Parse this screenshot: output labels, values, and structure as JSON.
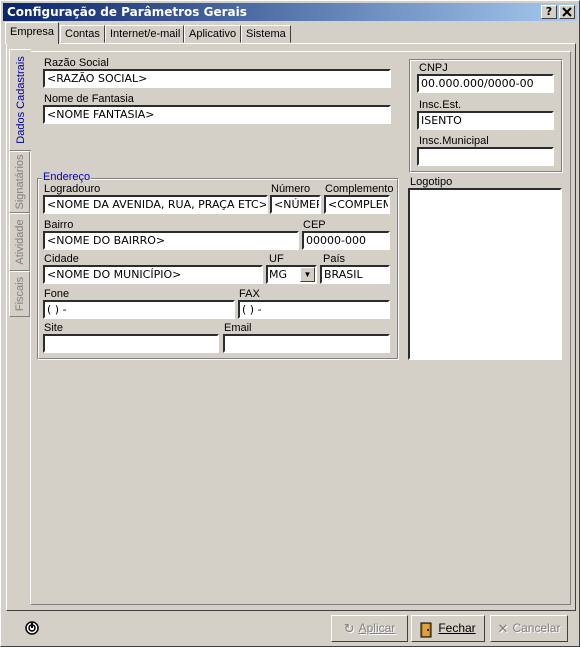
{
  "window": {
    "title": "Configuração de Parâmetros Gerais",
    "help_label": "?",
    "close_label": "X"
  },
  "tabs": [
    "Empresa",
    "Contas",
    "Internet/e-mail",
    "Aplicativo",
    "Sistema"
  ],
  "side_tabs": [
    "Dados Cadastrais",
    "Signatários",
    "Atividade",
    "Fiscais"
  ],
  "fields": {
    "razao_social": {
      "label": "Razão Social",
      "value": "<RAZÃO SOCIAL>"
    },
    "nome_fantasia": {
      "label": "Nome de Fantasia",
      "value": "<NOME FANTASIA>"
    },
    "cnpj": {
      "label": "CNPJ",
      "value": "00.000.000/0000-00"
    },
    "insc_est": {
      "label": "Insc.Est.",
      "value": "ISENTO"
    },
    "insc_municipal": {
      "label": "Insc.Municipal",
      "value": ""
    }
  },
  "endereco": {
    "legend": "Endereço",
    "logradouro": {
      "label": "Logradouro",
      "value": "<NOME DA AVENIDA, RUA, PRAÇA ETC>"
    },
    "numero": {
      "label": "Número",
      "value": "<NÚMERO>"
    },
    "complemento": {
      "label": "Complemento",
      "value": "<COMPLEMENTO>"
    },
    "bairro": {
      "label": "Bairro",
      "value": "<NOME DO BAIRRO>"
    },
    "cep": {
      "label": "CEP",
      "value": "00000-000"
    },
    "cidade": {
      "label": "Cidade",
      "value": "<NOME DO MUNICÍPIO>"
    },
    "uf": {
      "label": "UF",
      "value": "MG"
    },
    "pais": {
      "label": "País",
      "value": "BRASIL"
    },
    "fone": {
      "label": "Fone",
      "value": "(  )    -"
    },
    "fax": {
      "label": "FAX",
      "value": "(  )    -"
    },
    "site": {
      "label": "Site",
      "value": ""
    },
    "email": {
      "label": "Email",
      "value": ""
    }
  },
  "logotipo": {
    "label": "Logotipo"
  },
  "buttons": {
    "aplicar": "Aplicar",
    "fechar": "Fechar",
    "cancelar": "Cancelar"
  },
  "icons": {
    "status": "power-icon",
    "aplicar": "apply-icon",
    "fechar": "door-icon",
    "cancelar": "x-icon"
  }
}
